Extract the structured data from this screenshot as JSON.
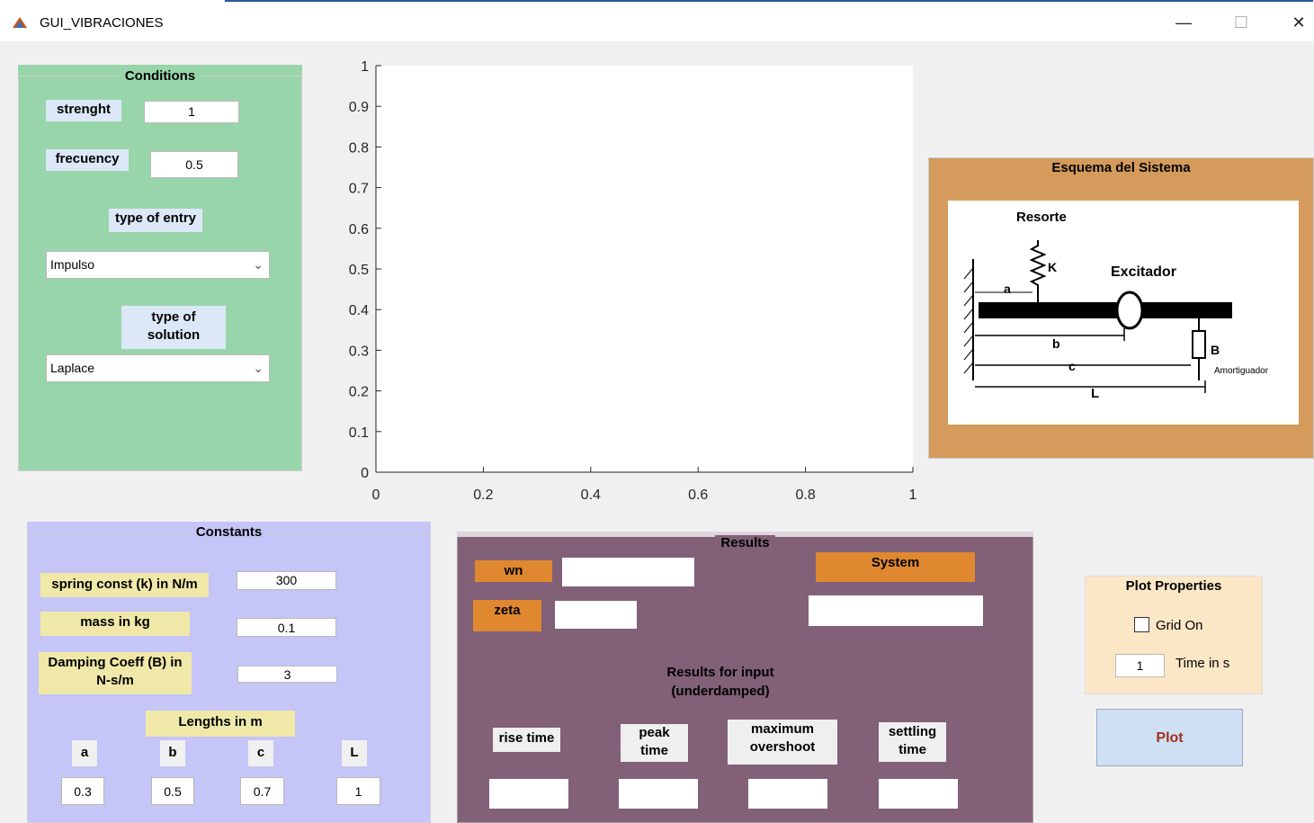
{
  "window": {
    "title": "GUI_VIBRACIONES",
    "minimize": "—",
    "maximize": "☐",
    "close": "✕"
  },
  "conditions": {
    "title": "Conditions",
    "strength_label": "strenght",
    "strength_value": "1",
    "frequency_label": "frecuency",
    "frequency_value": "0.5",
    "entry_type_label": "type of entry",
    "entry_type_selected": "Impulso",
    "solution_type_label_line1": "type of",
    "solution_type_label_line2": "solution",
    "solution_type_selected": "Laplace"
  },
  "axes": {
    "y_ticks": [
      "1",
      "0.9",
      "0.8",
      "0.7",
      "0.6",
      "0.5",
      "0.4",
      "0.3",
      "0.2",
      "0.1",
      "0"
    ],
    "x_ticks": [
      "0",
      "0.2",
      "0.4",
      "0.6",
      "0.8",
      "1"
    ]
  },
  "chart_data": {
    "type": "line",
    "series": [],
    "xlim": [
      0,
      1
    ],
    "ylim": [
      0,
      1
    ],
    "grid": false
  },
  "schema": {
    "title": "Esquema del Sistema",
    "labels": {
      "spring": "Resorte",
      "k": "K",
      "exciter": "Excitador",
      "a": "a",
      "b": "b",
      "c": "c",
      "L": "L",
      "B": "B",
      "damper": "Amortiguador"
    }
  },
  "constants": {
    "title": "Constants",
    "spring_label": "spring const (k) in N/m",
    "spring_value": "300",
    "mass_label": "mass in kg",
    "mass_value": "0.1",
    "damping_label_line1": "Damping Coeff (B) in",
    "damping_label_line2": "N-s/m",
    "damping_value": "3",
    "lengths_label": "Lengths in m",
    "a_label": "a",
    "b_label": "b",
    "c_label": "c",
    "L_label": "L",
    "a_value": "0.3",
    "b_value": "0.5",
    "c_value": "0.7",
    "L_value": "1"
  },
  "results": {
    "title": "Results",
    "wn_label": "wn",
    "zeta_label": "zeta",
    "system_label": "System",
    "input_results_line1": "Results for input",
    "input_results_line2": "(underdamped)",
    "rise_time": "rise time",
    "peak_time_line1": "peak",
    "peak_time_line2": "time",
    "overshoot_line1": "maximum",
    "overshoot_line2": "overshoot",
    "settling_line1": "settling",
    "settling_line2": "time"
  },
  "plot_properties": {
    "title": "Plot Properties",
    "grid_label": "Grid On",
    "time_value": "1",
    "time_label": "Time in s",
    "plot_button": "Plot"
  },
  "colors": {
    "conditions_bg": "#99d5aa",
    "constants_bg": "#c5c5f7",
    "results_bg": "#826078",
    "schema_bg": "#d49b5c",
    "plot_props_bg": "#fbe6c6",
    "plot_button_bg": "#cfe0f4",
    "plot_button_text": "#a0321b",
    "label_yellow": "#f0e8a8",
    "label_blue": "#dce8f8",
    "orange": "#e0882f"
  }
}
